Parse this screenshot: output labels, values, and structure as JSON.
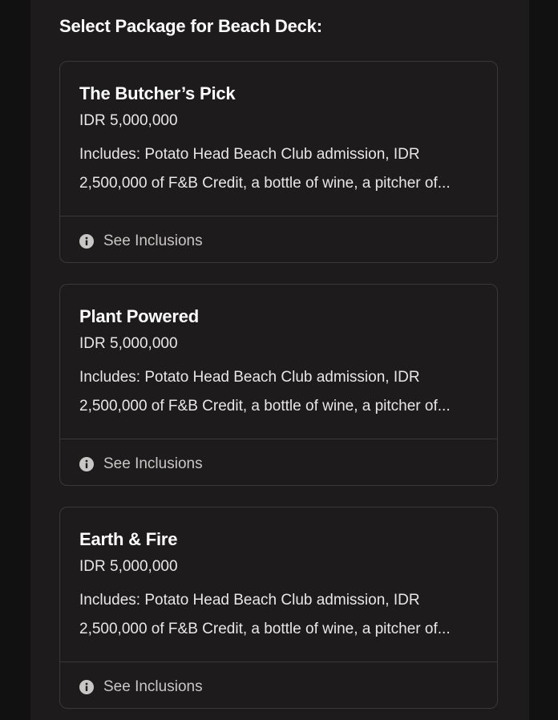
{
  "heading": "Select Package for Beach Deck:",
  "packages": [
    {
      "title": "The Butcher’s Pick",
      "price": "IDR 5,000,000",
      "description": "Includes: Potato Head Beach Club admission, IDR 2,500,000 of F&B Credit, a bottle of wine, a pitcher of...",
      "link_label": "See Inclusions"
    },
    {
      "title": "Plant Powered",
      "price": "IDR 5,000,000",
      "description": "Includes: Potato Head Beach Club admission, IDR 2,500,000 of F&B Credit, a bottle of wine, a pitcher of...",
      "link_label": "See Inclusions"
    },
    {
      "title": "Earth & Fire",
      "price": "IDR 5,000,000",
      "description": "Includes: Potato Head Beach Club admission, IDR 2,500,000 of F&B Credit, a bottle of wine, a pitcher of...",
      "link_label": "See Inclusions"
    }
  ],
  "icons": {
    "info": "info-circle-icon"
  },
  "colors": {
    "page_background": "#111111",
    "panel_background": "#1d1b1b",
    "card_border": "#3a3838",
    "text_primary": "#ffffff",
    "text_secondary": "#c9c6c6"
  }
}
